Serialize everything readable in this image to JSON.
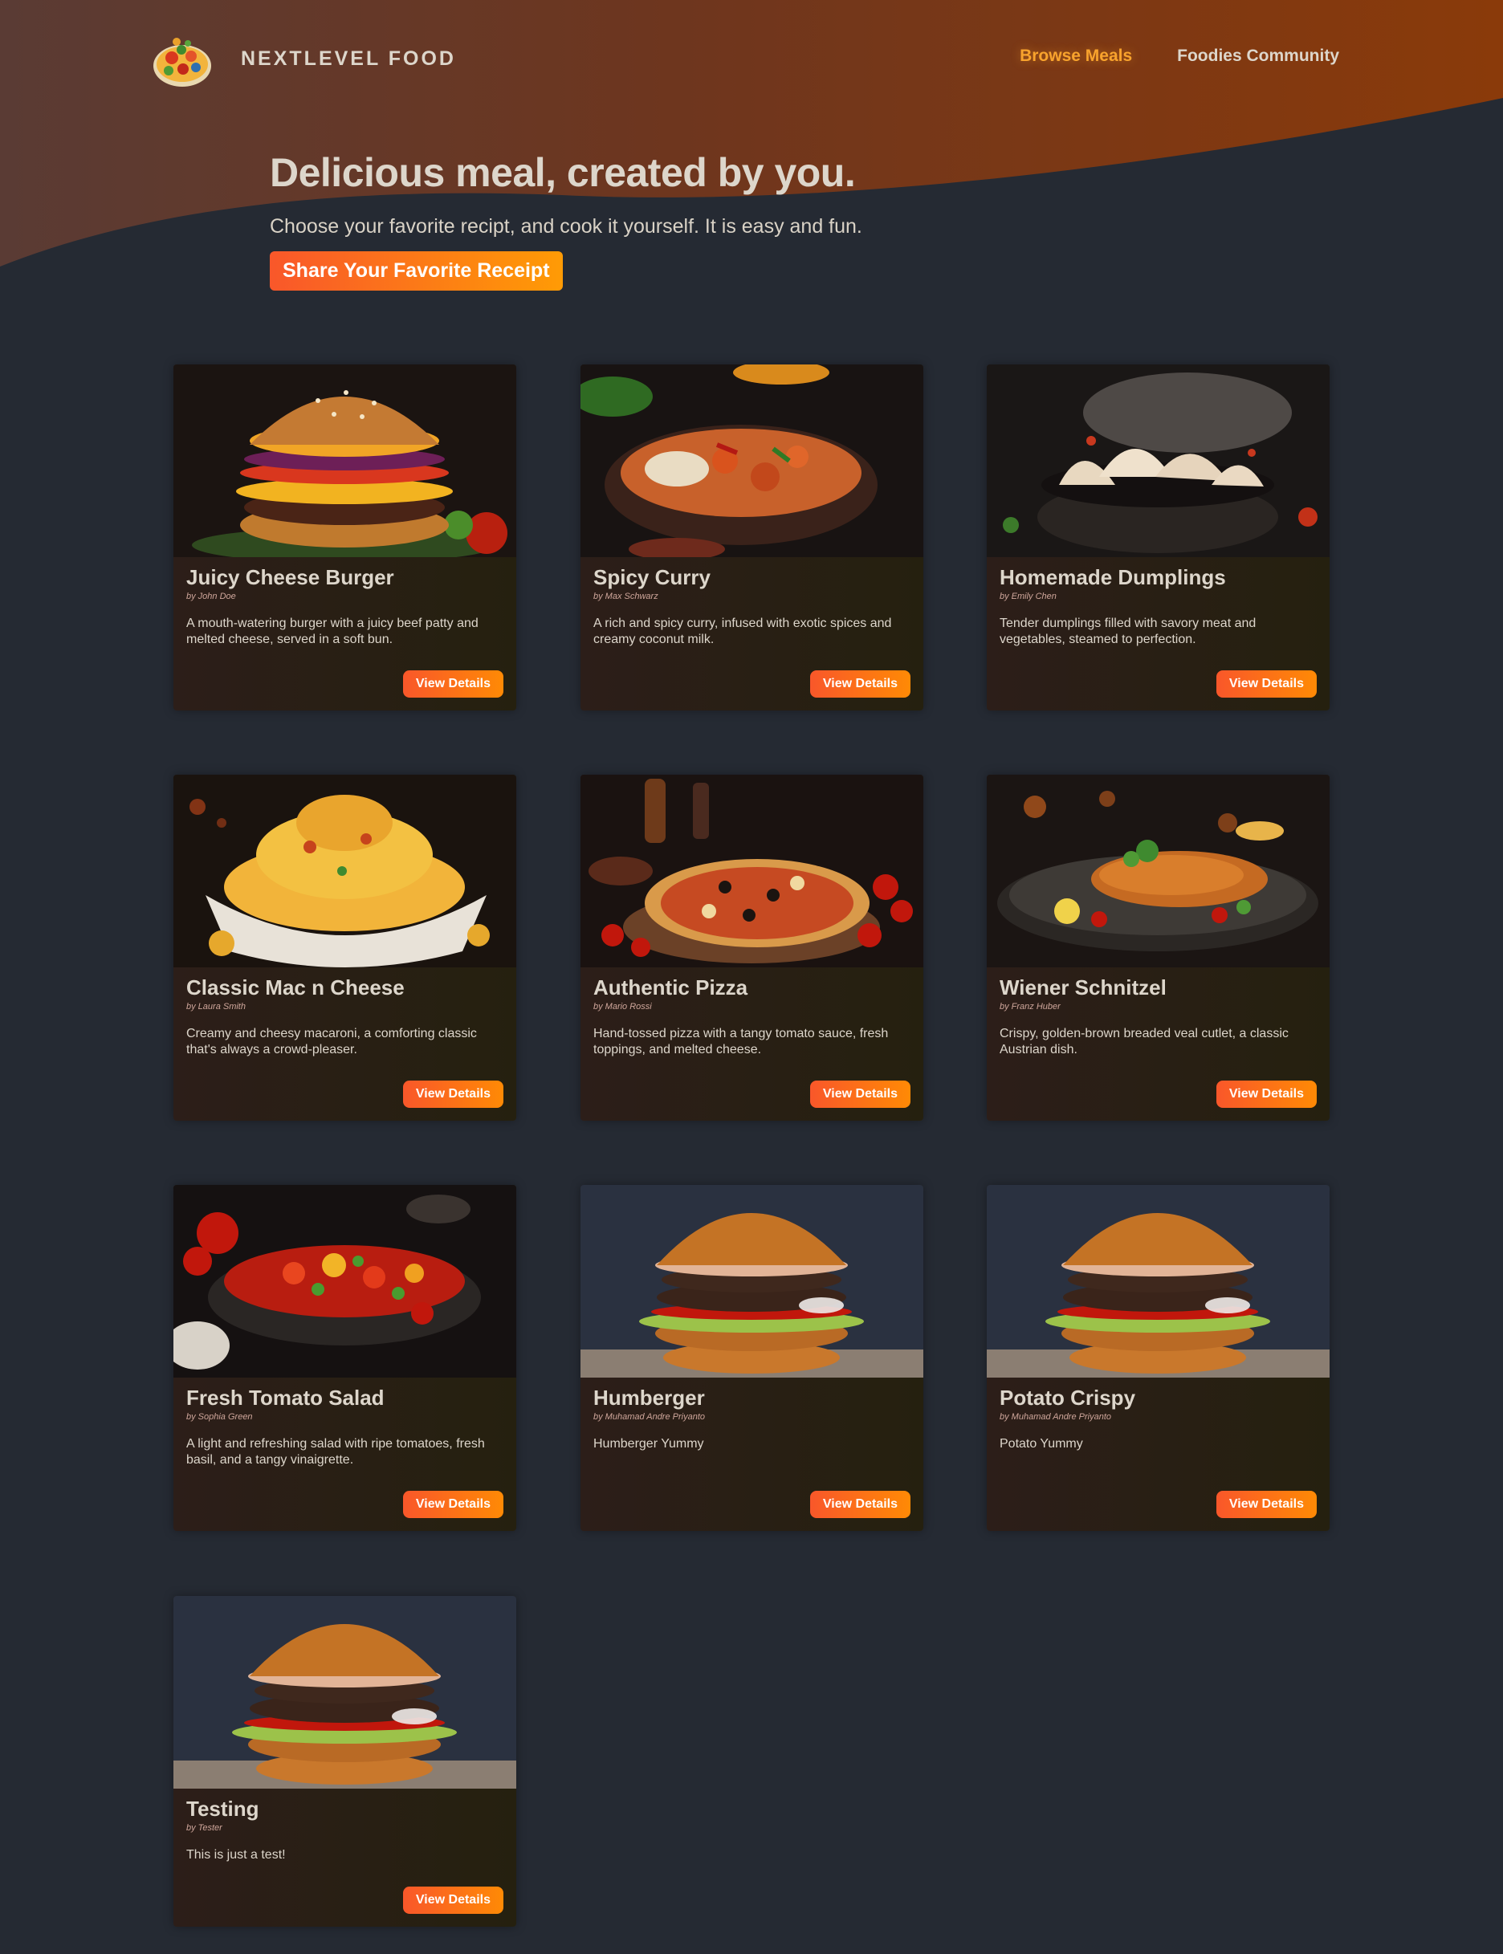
{
  "brand": {
    "name": "NextLevel Food"
  },
  "nav": {
    "items": [
      {
        "label": "Browse Meals",
        "active": true
      },
      {
        "label": "Foodies Community",
        "active": false
      }
    ]
  },
  "hero": {
    "title": "Delicious meal, created by you.",
    "subtitle": "Choose your favorite recipt, and cook it yourself. It is easy and fun.",
    "cta_label": "Share Your Favorite Receipt"
  },
  "colors": {
    "background": "#252a33",
    "accent_start": "#f9572a",
    "accent_end": "#ff9b05",
    "active_nav": "#f8a32d"
  },
  "meals": [
    {
      "title": "Juicy Cheese Burger",
      "creator": "by John Doe",
      "summary": "A mouth-watering burger with a juicy beef patty and melted cheese, served in a soft bun.",
      "button": "View Details",
      "image": "burger"
    },
    {
      "title": "Spicy Curry",
      "creator": "by Max Schwarz",
      "summary": "A rich and spicy curry, infused with exotic spices and creamy coconut milk.",
      "button": "View Details",
      "image": "curry"
    },
    {
      "title": "Homemade Dumplings",
      "creator": "by Emily Chen",
      "summary": "Tender dumplings filled with savory meat and vegetables, steamed to perfection.",
      "button": "View Details",
      "image": "dumplings"
    },
    {
      "title": "Classic Mac n Cheese",
      "creator": "by Laura Smith",
      "summary": "Creamy and cheesy macaroni, a comforting classic that's always a crowd-pleaser.",
      "button": "View Details",
      "image": "macncheese"
    },
    {
      "title": "Authentic Pizza",
      "creator": "by Mario Rossi",
      "summary": "Hand-tossed pizza with a tangy tomato sauce, fresh toppings, and melted cheese.",
      "button": "View Details",
      "image": "pizza"
    },
    {
      "title": "Wiener Schnitzel",
      "creator": "by Franz Huber",
      "summary": "Crispy, golden-brown breaded veal cutlet, a classic Austrian dish.",
      "button": "View Details",
      "image": "schnitzel"
    },
    {
      "title": "Fresh Tomato Salad",
      "creator": "by Sophia Green",
      "summary": "A light and refreshing salad with ripe tomatoes, fresh basil, and a tangy vinaigrette.",
      "button": "View Details",
      "image": "salad"
    },
    {
      "title": "Humberger",
      "creator": "by Muhamad Andre Priyanto",
      "summary": "Humberger Yummy",
      "button": "View Details",
      "image": "burger2"
    },
    {
      "title": "Potato Crispy",
      "creator": "by Muhamad Andre Priyanto",
      "summary": "Potato Yummy",
      "button": "View Details",
      "image": "burger2"
    },
    {
      "title": "Testing",
      "creator": "by Tester",
      "summary": "This is just a test!",
      "button": "View Details",
      "image": "burger2"
    }
  ]
}
